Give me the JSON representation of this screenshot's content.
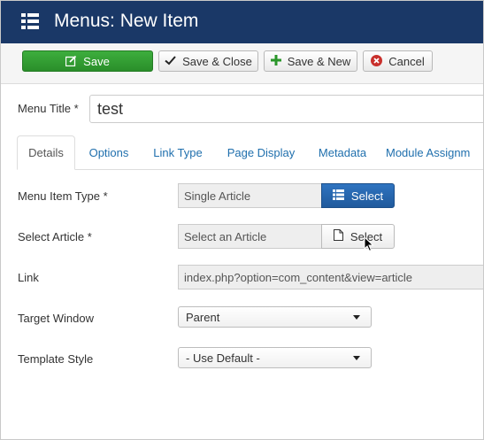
{
  "header": {
    "title": "Menus: New Item",
    "icon": "list-icon",
    "background": "#1a3867"
  },
  "toolbar": {
    "save_label": "Save",
    "save_close_label": "Save & Close",
    "save_new_label": "Save & New",
    "cancel_label": "Cancel"
  },
  "form": {
    "menu_title_label": "Menu Title *",
    "menu_title_value": "test"
  },
  "tabs": [
    {
      "label": "Details",
      "active": true
    },
    {
      "label": "Options"
    },
    {
      "label": "Link Type"
    },
    {
      "label": "Page Display"
    },
    {
      "label": "Metadata"
    },
    {
      "label": "Module Assignm"
    }
  ],
  "fields": {
    "menu_item_type": {
      "label": "Menu Item Type *",
      "value": "Single Article",
      "button": "Select"
    },
    "select_article": {
      "label": "Select Article *",
      "value": "Select an Article",
      "button": "Select"
    },
    "link": {
      "label": "Link",
      "value": "index.php?option=com_content&view=article"
    },
    "target_window": {
      "label": "Target Window",
      "value": "Parent"
    },
    "template_style": {
      "label": "Template Style",
      "value": "- Use Default -"
    }
  },
  "colors": {
    "save": "#2f9e2f",
    "primary": "#2a6ab2",
    "link": "#1f6fad"
  }
}
